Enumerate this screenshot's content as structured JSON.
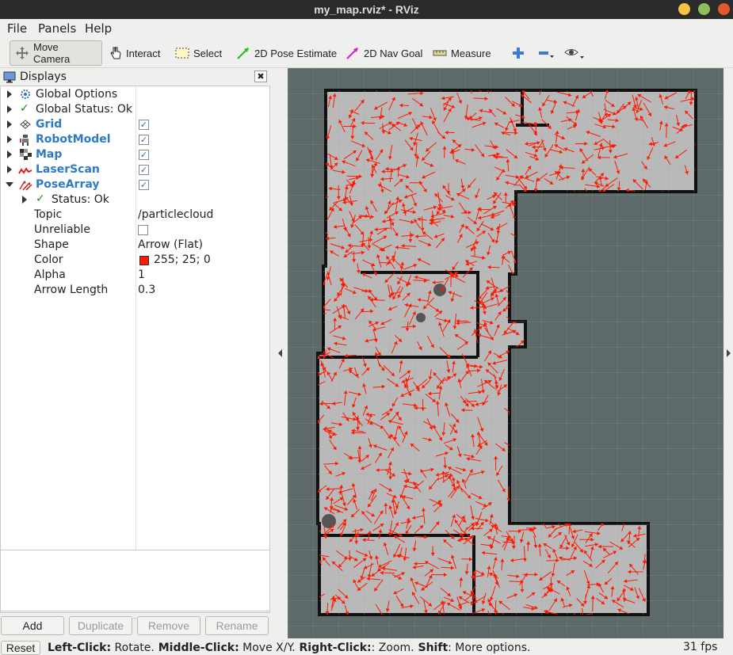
{
  "window": {
    "title": "my_map.rviz* - RViz"
  },
  "menu": {
    "file": "File",
    "panels": "Panels",
    "help": "Help"
  },
  "toolbar": {
    "move_camera": "Move Camera",
    "interact": "Interact",
    "select": "Select",
    "pose_estimate": "2D Pose Estimate",
    "nav_goal": "2D Nav Goal",
    "measure": "Measure"
  },
  "displays": {
    "title": "Displays",
    "items": [
      {
        "label": "Global Options"
      },
      {
        "label": "Global Status: Ok"
      },
      {
        "label": "Grid",
        "checked": true
      },
      {
        "label": "RobotModel",
        "checked": true
      },
      {
        "label": "Map",
        "checked": true
      },
      {
        "label": "LaserScan",
        "checked": true
      },
      {
        "label": "PoseArray",
        "checked": true
      }
    ],
    "pose_array": {
      "status": "Status: Ok",
      "props": [
        {
          "name": "Topic",
          "value": "/particlecloud"
        },
        {
          "name": "Unreliable",
          "value": ""
        },
        {
          "name": "Shape",
          "value": "Arrow (Flat)"
        },
        {
          "name": "Color",
          "value": "255; 25; 0"
        },
        {
          "name": "Alpha",
          "value": "1"
        },
        {
          "name": "Arrow Length",
          "value": "0.3"
        }
      ]
    }
  },
  "buttons": {
    "add": "Add",
    "duplicate": "Duplicate",
    "remove": "Remove",
    "rename": "Rename"
  },
  "status": {
    "reset": "Reset",
    "left_click_key": "Left-Click:",
    "left_click_val": " Rotate.",
    "middle_click_key": " Middle-Click:",
    "middle_click_val": " Move X/Y.",
    "right_click_key": " Right-Click:",
    "right_click_val": ": Zoom.",
    "shift_key": " Shift",
    "shift_val": ": More options.",
    "fps": "31 fps"
  },
  "colors": {
    "accent": "#2d7ac7",
    "particle": "#ff1900",
    "viewport_bg": "#5d6a69",
    "map_free": "#b9b9b9"
  }
}
